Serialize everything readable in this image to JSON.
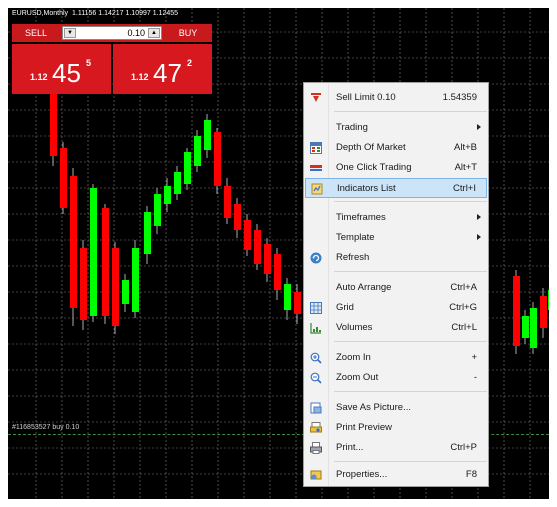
{
  "chart": {
    "symbol_title": "EURUSD,Monthly",
    "ohlc": "1.11156 1.14217 1.10997 1.12455",
    "order_label": "#116853527 buy 0.10"
  },
  "trade_panel": {
    "sell_label": "SELL",
    "buy_label": "BUY",
    "volume_value": "0.10",
    "sell_price": {
      "prefix": "1.12",
      "big": "45",
      "sup": "5"
    },
    "buy_price": {
      "prefix": "1.12",
      "big": "47",
      "sup": "2"
    }
  },
  "context_menu": {
    "items": [
      {
        "label": "Sell Limit 0.10",
        "shortcut": "1.54359",
        "icon": "sell-limit-icon"
      },
      {
        "label": "Trading",
        "shortcut": "",
        "submenu": true
      },
      {
        "label": "Depth Of Market",
        "shortcut": "Alt+B",
        "icon": "depth-of-market-icon"
      },
      {
        "label": "One Click Trading",
        "shortcut": "Alt+T",
        "icon": "one-click-trading-icon"
      },
      {
        "label": "Indicators List",
        "shortcut": "Ctrl+I",
        "icon": "indicators-list-icon",
        "highlighted": true
      },
      {
        "label": "Timeframes",
        "shortcut": "",
        "submenu": true
      },
      {
        "label": "Template",
        "shortcut": "",
        "submenu": true
      },
      {
        "label": "Refresh",
        "shortcut": "",
        "icon": "refresh-icon"
      },
      {
        "label": "Auto Arrange",
        "shortcut": "Ctrl+A"
      },
      {
        "label": "Grid",
        "shortcut": "Ctrl+G",
        "icon": "grid-icon"
      },
      {
        "label": "Volumes",
        "shortcut": "Ctrl+L",
        "icon": "volumes-icon"
      },
      {
        "label": "Zoom In",
        "shortcut": "+",
        "icon": "zoom-in-icon"
      },
      {
        "label": "Zoom Out",
        "shortcut": "-",
        "icon": "zoom-out-icon"
      },
      {
        "label": "Save As Picture...",
        "shortcut": "",
        "icon": "save-picture-icon"
      },
      {
        "label": "Print Preview",
        "shortcut": "",
        "icon": "print-preview-icon"
      },
      {
        "label": "Print...",
        "shortcut": "Ctrl+P",
        "icon": "print-icon"
      },
      {
        "label": "Properties...",
        "shortcut": "F8",
        "icon": "properties-icon"
      }
    ]
  },
  "colors": {
    "chart_background": "#000000",
    "bull_candle": "#00ff00",
    "bear_candle": "#ff0000",
    "grid": "#7f7f7f",
    "trade_panel": "#d7191f",
    "menu_highlight": "#cce4f7"
  }
}
